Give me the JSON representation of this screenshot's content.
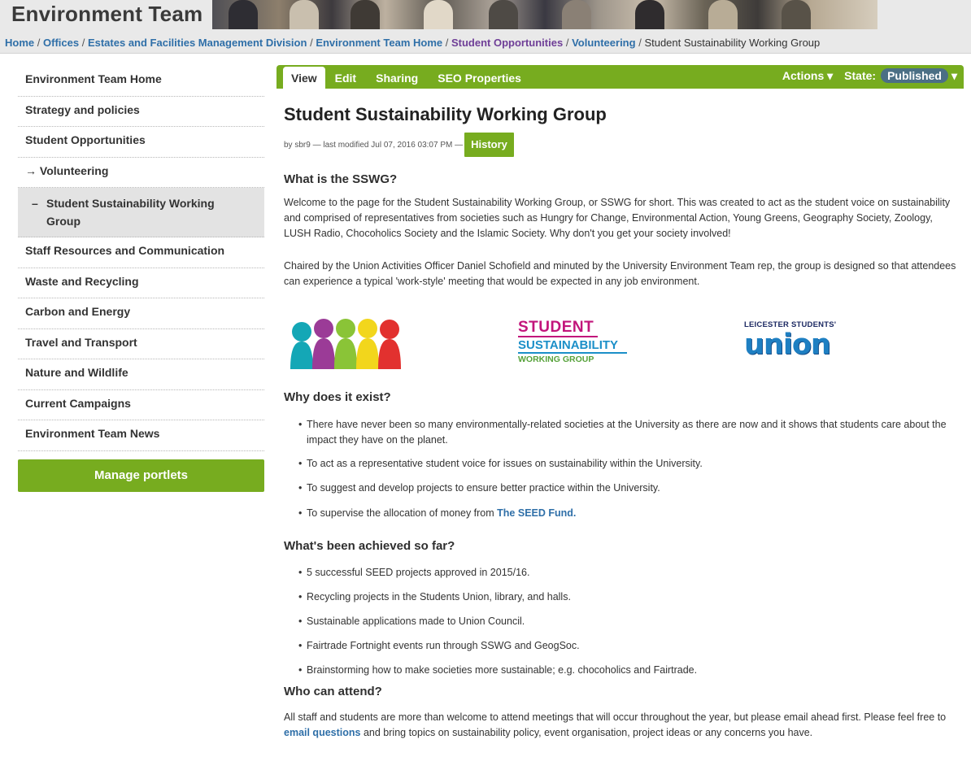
{
  "header": {
    "site_title": "Environment Team",
    "breadcrumb": [
      {
        "label": "Home",
        "visited": false
      },
      {
        "label": "Offices",
        "visited": false
      },
      {
        "label": "Estates and Facilities Management Division",
        "visited": false
      },
      {
        "label": "Environment Team Home",
        "visited": false
      },
      {
        "label": "Student Opportunities",
        "visited": true
      },
      {
        "label": "Volunteering",
        "visited": false
      }
    ],
    "breadcrumb_current": "Student Sustainability Working Group",
    "separator": "/"
  },
  "sidebar": {
    "items": [
      {
        "label": "Environment Team Home"
      },
      {
        "label": "Strategy and policies"
      },
      {
        "label": "Student Opportunities"
      },
      {
        "label": "→ Volunteering"
      },
      {
        "label": "Student Sustainability Working Group",
        "marker": "–",
        "current": true
      },
      {
        "label": "Staff Resources and Communication"
      },
      {
        "label": "Waste and Recycling"
      },
      {
        "label": "Carbon and Energy"
      },
      {
        "label": "Travel and Transport"
      },
      {
        "label": "Nature and Wildlife"
      },
      {
        "label": "Current Campaigns"
      },
      {
        "label": "Environment Team News"
      }
    ],
    "manage_portlets": "Manage portlets"
  },
  "editbar": {
    "tabs": [
      "View",
      "Edit",
      "Sharing",
      "SEO Properties"
    ],
    "active_tab": "View",
    "actions": "Actions ▾",
    "state_label": "State:",
    "state_value": "Published",
    "state_caret": "▾",
    "colors": {
      "green": "#77ac1f",
      "badge": "#4b6f85"
    }
  },
  "content": {
    "title": "Student Sustainability Working Group",
    "byline": "by sbr9 — last modified Jul 07, 2016 03:07 PM —",
    "history": "History",
    "s1_heading": "What is the SSWG?",
    "s1_p1": "Welcome to the page for the Student Sustainability Working Group, or SSWG for short. This was created to act as the student voice on sustainability and comprised of representatives from societies such as Hungry for Change, Environmental Action, Young Greens, Geography Society, Zoology, LUSH Radio, Chocoholics Society and the Islamic Society. Why don't you get your society involved!",
    "s1_p2": "Chaired by the Union Activities Officer Daniel Schofield and minuted by the University Environment Team rep, the group is designed so that attendees can experience a typical 'work-style' meeting that would be expected in any job environment.",
    "logos": {
      "sswg_l1": "STUDENT",
      "sswg_l2": "SUSTAINABILITY",
      "sswg_l3": "WORKING GROUP",
      "union_top": "LEICESTER STUDENTS'",
      "union_word": "union"
    },
    "s2_heading": "Why does it exist?",
    "s2_items": [
      "There have never been so many environmentally-related societies at the University as there are now and it shows that students care about the impact they have on the planet.",
      "To act as a representative student voice for issues on sustainability within the University.",
      "To suggest and develop projects to ensure better practice within the University."
    ],
    "s2_last_prefix": "To supervise the allocation of money from",
    "s2_last_link": "The SEED Fund.",
    "s3_heading": "What's been achieved so far?",
    "s3_items": [
      "5 successful SEED projects approved in 2015/16.",
      "Recycling projects in the Students Union, library, and halls.",
      "Sustainable applications made to Union Council.",
      "Fairtrade Fortnight events run through SSWG and GeogSoc.",
      "Brainstorming how to make societies more sustainable; e.g. chocoholics and Fairtrade."
    ],
    "s4_heading": "Who can attend?",
    "s4_part1": "All staff and students are more than welcome to attend meetings that will occur throughout the year, but please email ahead first. Please feel free to",
    "s4_link": "email questions",
    "s4_part2": "and bring topics on sustainability policy, event organisation, project ideas or any concerns you have."
  }
}
